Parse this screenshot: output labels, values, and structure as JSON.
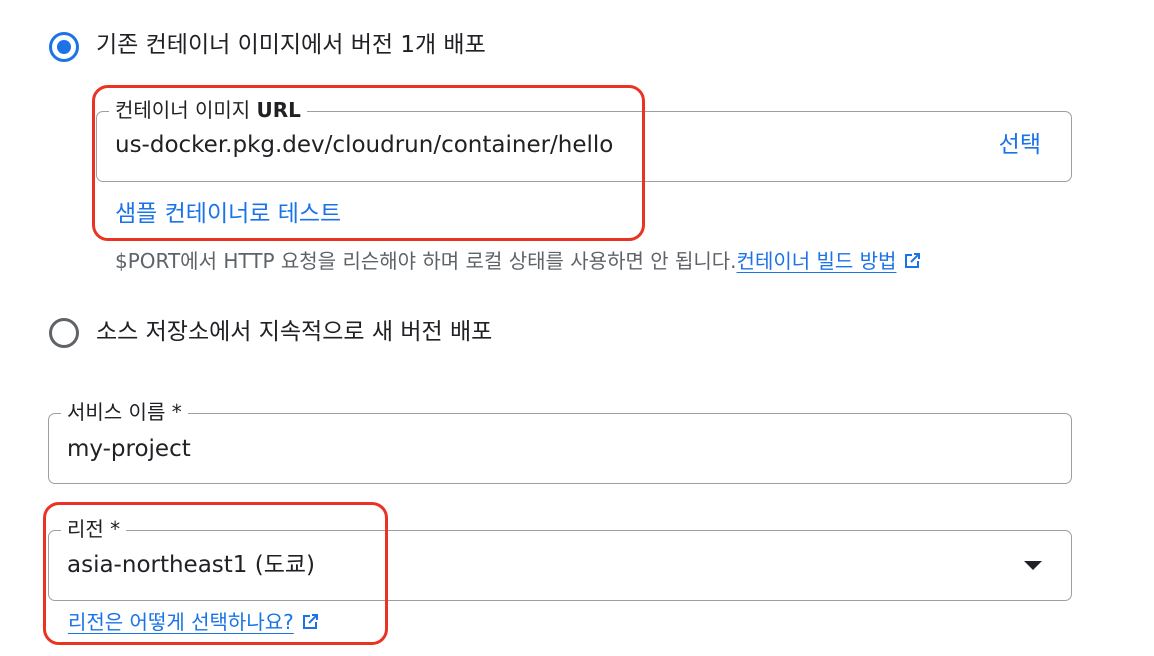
{
  "deploy_options": {
    "existing_image_label": "기존 컨테이너 이미지에서 버전 1개 배포",
    "existing_image_selected": true,
    "source_repo_label": "소스 저장소에서 지속적으로 새 버전 배포",
    "source_repo_selected": false
  },
  "container_image": {
    "label_prefix": "컨테이너 이미지 ",
    "label_bold": "URL",
    "value": "us-docker.pkg.dev/cloudrun/container/hello",
    "select_button": "선택",
    "test_link": "샘플 컨테이너로 테스트",
    "hint_text": "$PORT에서 HTTP 요청을 리슨해야 하며 로컬 상태를 사용하면 안 됩니다.",
    "hint_link": "컨테이너 빌드 방법",
    "hint_link_icon": "open-in-new-icon"
  },
  "service_name": {
    "label": "서비스 이름 *",
    "value": "my-project"
  },
  "region": {
    "label": "리전 *",
    "value": "asia-northeast1 (도쿄)",
    "help_link": "리전은 어떻게 선택하나요?",
    "help_link_icon": "open-in-new-icon",
    "dropdown_icon": "arrow-drop-down-icon"
  },
  "colors": {
    "accent": "#1a73e8",
    "highlight_box": "#ea3323",
    "text": "#202124",
    "secondary_text": "#5f6368"
  }
}
